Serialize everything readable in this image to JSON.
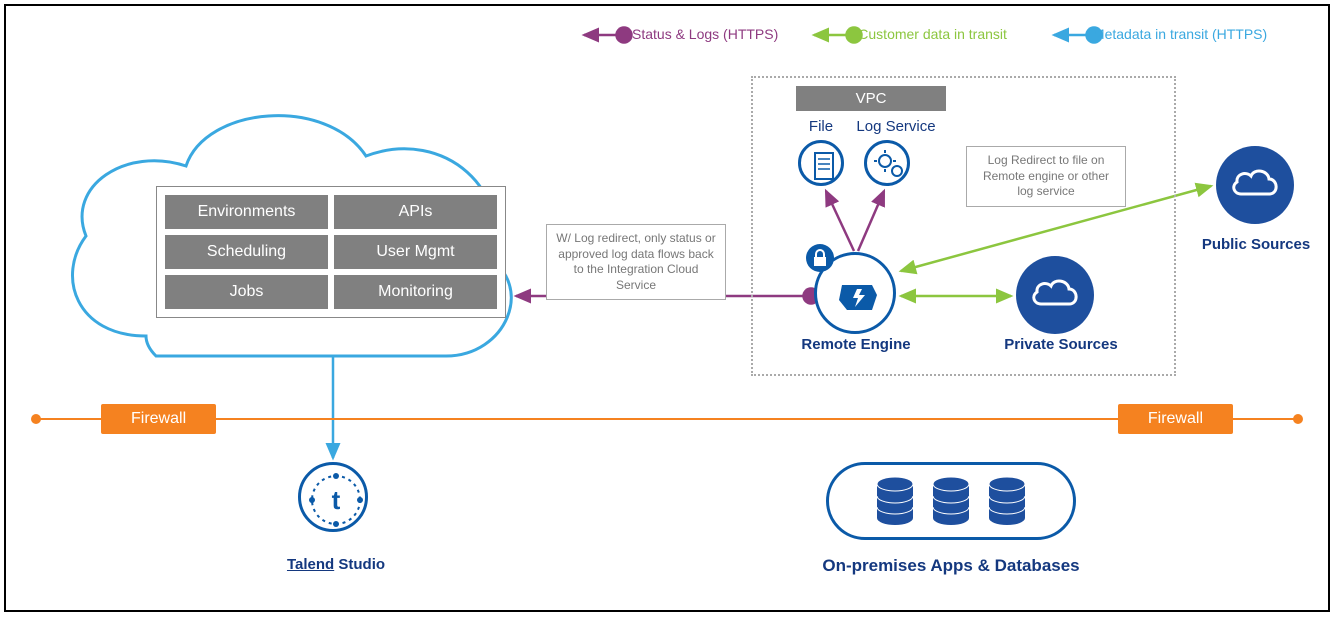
{
  "legend": {
    "status": "Status & Logs (HTTPS)",
    "customer_data": "Customer data in transit",
    "metadata": "Metadata in transit (HTTPS)"
  },
  "cloud_boxes": {
    "environments": "Environments",
    "apis": "APIs",
    "scheduling": "Scheduling",
    "user_mgmt": "User Mgmt",
    "jobs": "Jobs",
    "monitoring": "Monitoring"
  },
  "vpc": {
    "label": "VPC",
    "file": "File",
    "log_service": "Log Service",
    "remote_engine": "Remote Engine",
    "private_sources": "Private Sources"
  },
  "public_sources": "Public Sources",
  "notes": {
    "log_redirect_note": "W/ Log redirect, only status or approved log data flows back to the Integration Cloud Service",
    "log_redirect_file": "Log Redirect to file on Remote engine or other log service"
  },
  "firewall": "Firewall",
  "studio": {
    "brand": "Talend",
    "product": " Studio"
  },
  "on_premises": "On-premises Apps & Databases",
  "colors": {
    "status_line": "#8e3a80",
    "data_line": "#8cc63f",
    "meta_line": "#3aa8e0",
    "firewall": "#f58220",
    "brand_blue": "#14387f",
    "circle_blue": "#0b5aa8"
  }
}
